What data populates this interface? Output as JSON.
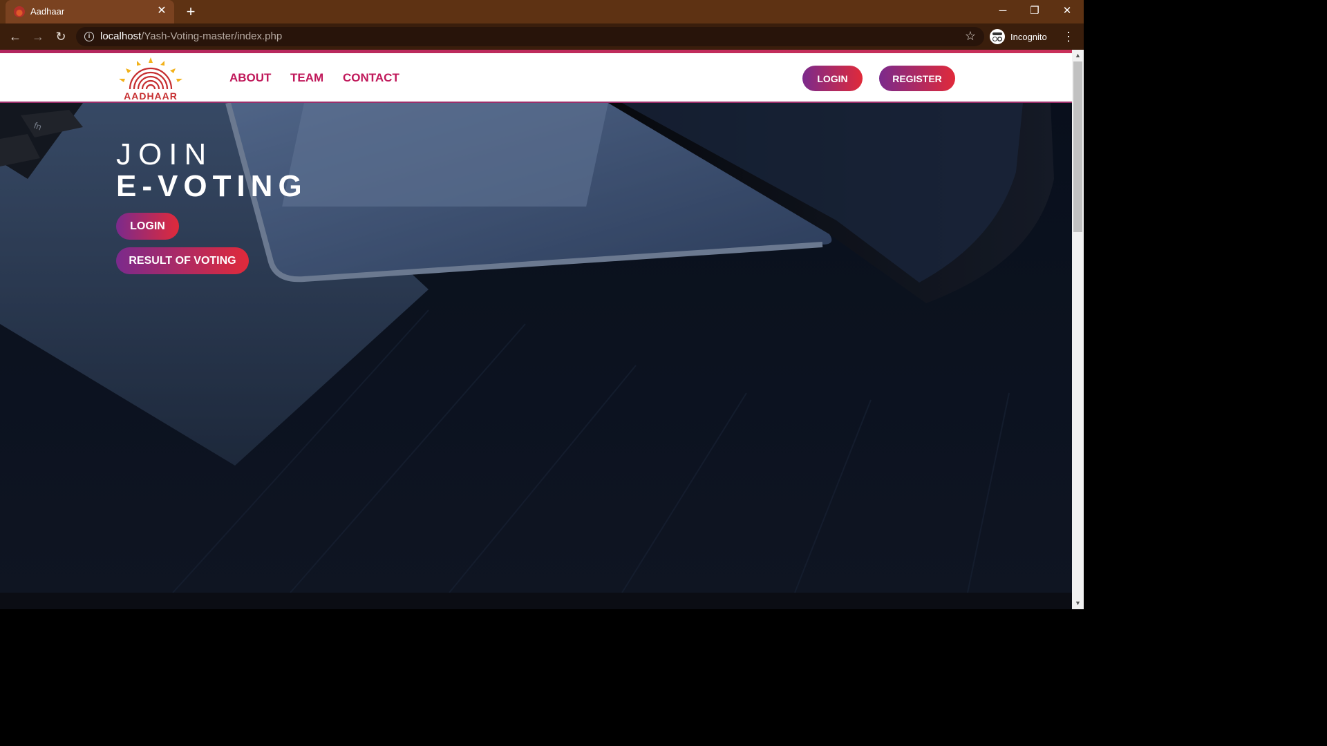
{
  "browser": {
    "tab_title": "Aadhaar",
    "url_host": "localhost",
    "url_path": "/Yash-Voting-master/index.php",
    "profile_label": "Incognito"
  },
  "header": {
    "logo_text": "AADHAAR",
    "nav": {
      "about": "ABOUT",
      "team": "TEAM",
      "contact": "CONTACT"
    },
    "login_label": "LOGIN",
    "register_label": "REGISTER"
  },
  "hero": {
    "line1": "JOIN",
    "line2": "E-VOTING",
    "login_label": "LOGIN",
    "result_label": "RESULT OF VOTING"
  },
  "colors": {
    "accent_pink": "#c0185a",
    "button_gradient_start": "#7b2a8c",
    "button_gradient_end": "#e02a3a",
    "titlebar": "#5e3213"
  },
  "icons": [
    "favicon-icon",
    "close-icon",
    "plus-icon",
    "minimize-icon",
    "maximize-icon",
    "back-icon",
    "forward-icon",
    "reload-icon",
    "info-icon",
    "star-icon",
    "incognito-icon",
    "kebab-menu-icon"
  ]
}
